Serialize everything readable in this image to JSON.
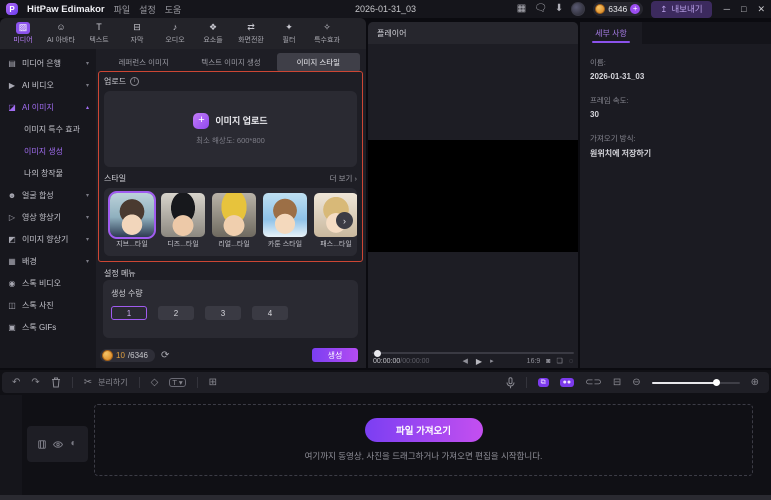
{
  "titlebar": {
    "app_name": "HitPaw Edimakor",
    "menus": [
      "파일",
      "설정",
      "도움"
    ],
    "project_name": "2026-01-31_03",
    "credits": "6346",
    "export_label": "내보내기",
    "window": {
      "minimize": "─",
      "maximize": "□",
      "close": "✕"
    }
  },
  "media_tabs": [
    {
      "label": "미디어",
      "glyph": "▨"
    },
    {
      "label": "AI 아바타",
      "glyph": "☺"
    },
    {
      "label": "텍스트",
      "glyph": "T"
    },
    {
      "label": "자막",
      "glyph": "⊟"
    },
    {
      "label": "오디오",
      "glyph": "♪"
    },
    {
      "label": "요소들",
      "glyph": "❖"
    },
    {
      "label": "화면전환",
      "glyph": "⇄"
    },
    {
      "label": "필터",
      "glyph": "✦"
    },
    {
      "label": "특수효과",
      "glyph": "✧"
    }
  ],
  "sidebar": {
    "items": [
      {
        "label": "미디어 은행",
        "glyph": "▤",
        "caret": "▾"
      },
      {
        "label": "AI 비디오",
        "glyph": "▶",
        "caret": "▾"
      },
      {
        "label": "AI 이미지",
        "glyph": "◪",
        "caret": "▴"
      },
      {
        "label": "얼굴 합성",
        "glyph": "☻",
        "caret": "▾"
      },
      {
        "label": "영상 향상기",
        "glyph": "▷",
        "caret": "▾"
      },
      {
        "label": "이미지 향상기",
        "glyph": "◩",
        "caret": "▾"
      },
      {
        "label": "배경",
        "glyph": "▦",
        "caret": "▾"
      },
      {
        "label": "스톡 비디오",
        "glyph": "◉",
        "caret": ""
      },
      {
        "label": "스톡 사진",
        "glyph": "◫",
        "caret": ""
      },
      {
        "label": "스톡 GIFs",
        "glyph": "▣",
        "caret": ""
      }
    ],
    "ai_image_children": [
      {
        "label": "이미지 특수 효과"
      },
      {
        "label": "이미지 생성"
      },
      {
        "label": "나의 창작물"
      }
    ]
  },
  "generator": {
    "tabs": [
      "레퍼런스 이미지",
      "텍스트 이미지 생성",
      "이미지 스타일"
    ],
    "upload_label": "업로드",
    "info_glyph": "i",
    "upload_button": "이미지 업로드",
    "upload_hint": "최소 해상도: 600*800",
    "style_label": "스타일",
    "more_label": "더 보기 ›",
    "styles": [
      "지브...타일",
      "디즈...타일",
      "리얼...타일",
      "카툰 스타일",
      "패스...타일"
    ],
    "nav_glyph": "›",
    "settings_label": "설정 메뉴",
    "quantity_label": "생성 수량",
    "quantities": [
      "1",
      "2",
      "3",
      "4"
    ],
    "credit_used": "10",
    "credit_total": "/6346",
    "generate_label": "생성"
  },
  "player": {
    "title": "플레이어",
    "time_current": "00:00:00",
    "time_separator": " / ",
    "time_total": "00:00:00",
    "prev_glyph": "◀",
    "play_glyph": "▶",
    "next_glyph": "▸",
    "ratio": "16:9",
    "snapshot_glyph": "◙",
    "fit_glyph": "❏",
    "loop_glyph": "◌"
  },
  "details": {
    "tab": "세부 사항",
    "fields": [
      {
        "label": "이름:",
        "value": "2026-01-31_03"
      },
      {
        "label": "프레임 속도:",
        "value": "30"
      },
      {
        "label": "가져오기 방식:",
        "value": "원위치에 저장하기"
      }
    ]
  },
  "timeline": {
    "undo_glyph": "↶",
    "redo_glyph": "↷",
    "scissors_glyph": "✂",
    "split_label": "분리하기",
    "mask_glyph": "◇",
    "text_tool_glyph": "T ▾",
    "add_frame_glyph": "⊞",
    "link_glyph": "⧉",
    "magnet_glyph": "●●",
    "unlink_glyph": "⊂⊃",
    "fit_glyph": "⊟",
    "zoom_out_glyph": "⊖",
    "zoom_in_glyph": "⊕",
    "mute_glyph": "◐",
    "import_label": "파일 가져오기",
    "drop_hint": "여기까지 동영상, 사진을 드래그하거나 가져오면 편집을 시작합니다."
  }
}
